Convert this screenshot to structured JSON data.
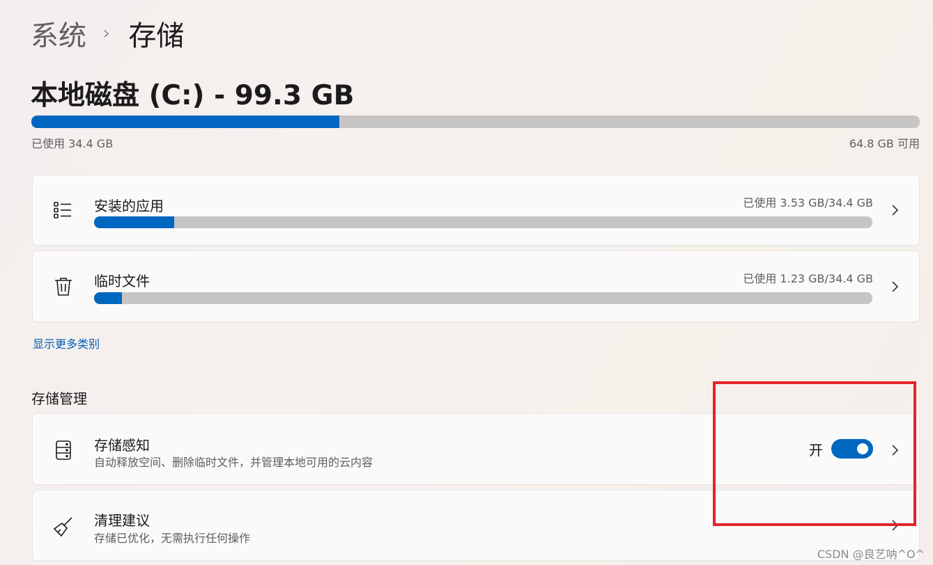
{
  "breadcrumb": {
    "parent": "系统",
    "separator": "›",
    "current": "存储"
  },
  "disk": {
    "title": "本地磁盘 (C:) - 99.3 GB",
    "used_label": "已使用 34.4 GB",
    "free_label": "64.8 GB 可用",
    "used_fraction": 0.3465
  },
  "categories": [
    {
      "name": "安装的应用",
      "usage": "已使用 3.53 GB/34.4 GB",
      "icon": "list-icon",
      "used_fraction": 0.103
    },
    {
      "name": "临时文件",
      "usage": "已使用 1.23 GB/34.4 GB",
      "icon": "trash-icon",
      "used_fraction": 0.036
    }
  ],
  "more_link": "显示更多类别",
  "management": {
    "title": "存储管理",
    "items": [
      {
        "name": "存储感知",
        "desc": "自动释放空间、删除临时文件，并管理本地可用的云内容",
        "icon": "storage-drive-icon",
        "toggle_label": "开",
        "toggle_on": true
      },
      {
        "name": "清理建议",
        "desc": "存储已优化，无需执行任何操作",
        "icon": "broom-icon"
      }
    ]
  },
  "watermark": "CSDN @良艺呐^O^",
  "colors": {
    "accent": "#0067c0",
    "track": "#c7c5c4",
    "link": "#005fb8",
    "highlight_box": "#e3242b"
  }
}
